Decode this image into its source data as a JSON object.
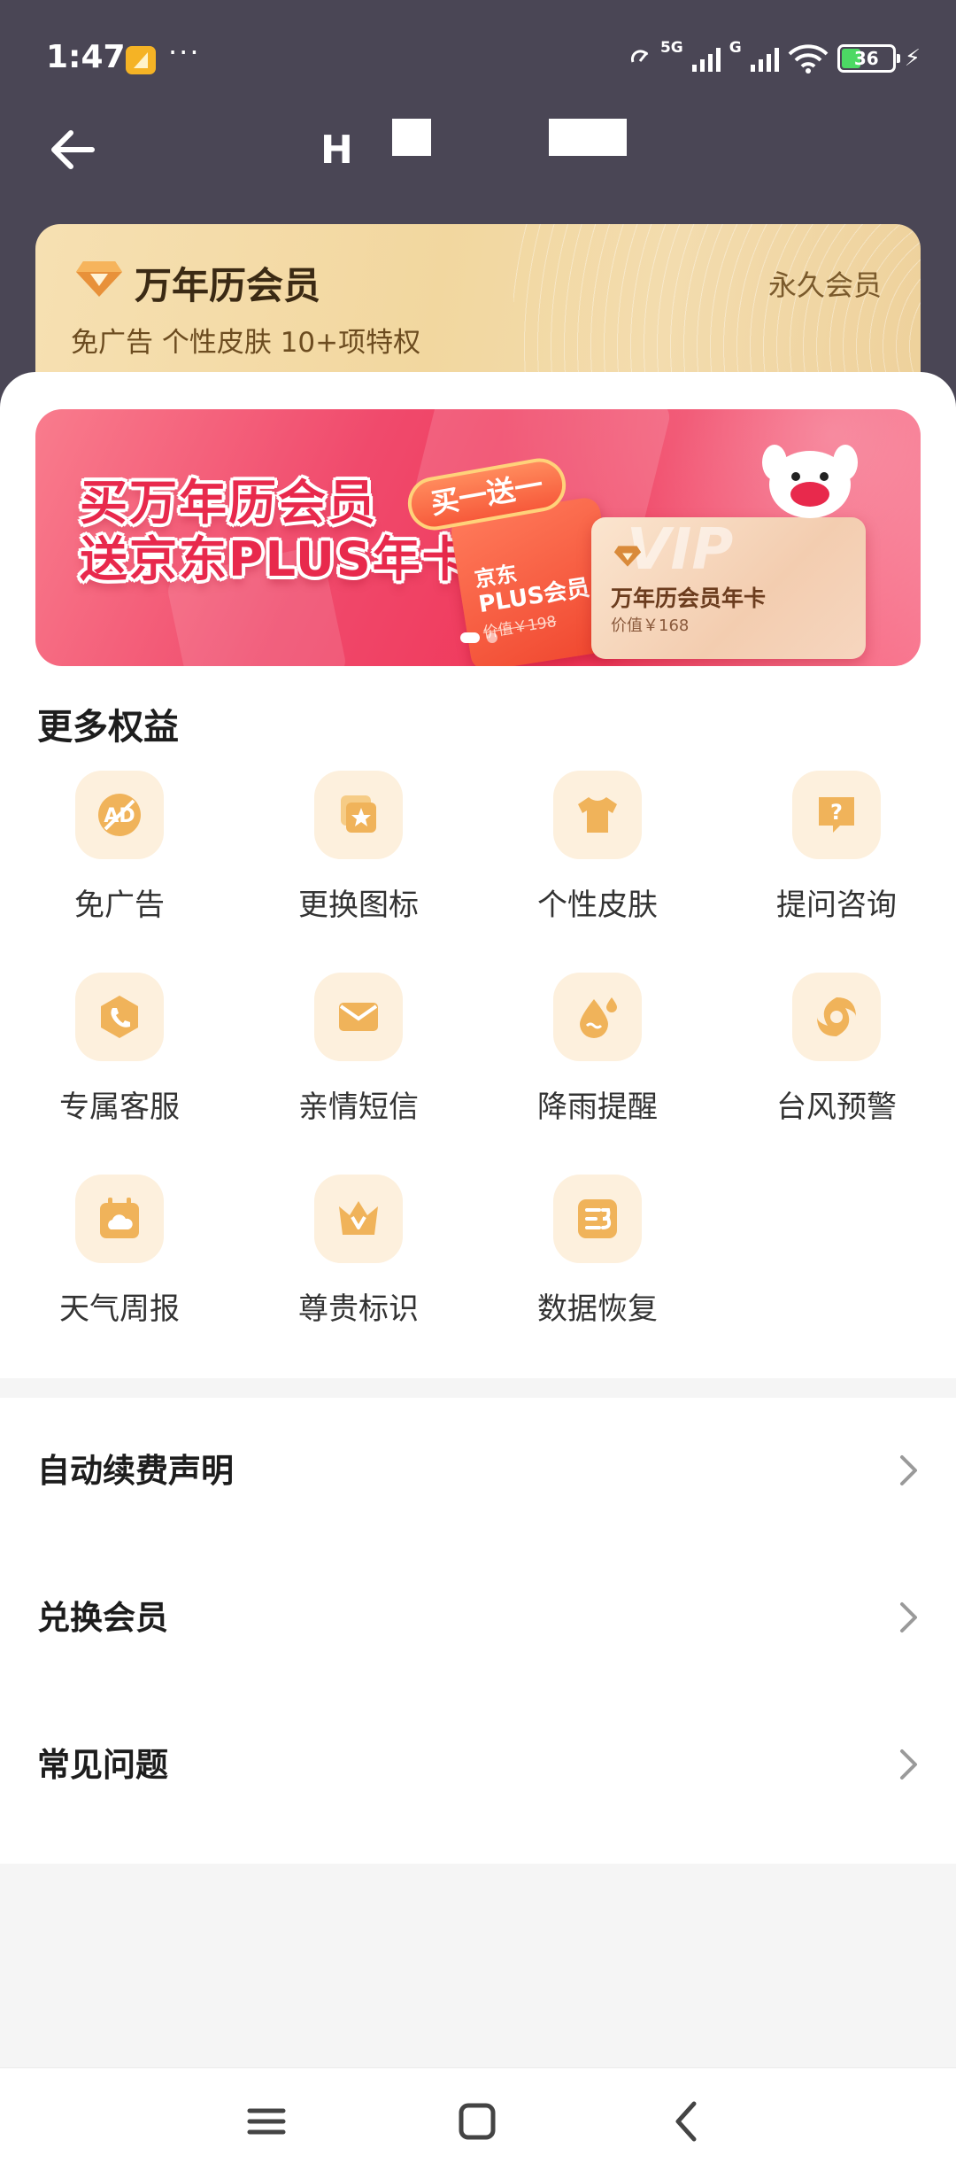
{
  "status_bar": {
    "time": "1:47",
    "more": "···",
    "network_labels": [
      "5G",
      "G"
    ],
    "battery": "36"
  },
  "nav": {
    "title_visible": "H"
  },
  "member_card": {
    "title": "万年历会员",
    "status": "永久会员",
    "subtitle": "免广告 个性皮肤 10+项特权"
  },
  "banner": {
    "headline_line1": "买万年历会员",
    "headline_line2": "送京东PLUS年卡",
    "tag": "买一送一",
    "jd_card_line1": "京东",
    "jd_card_line2": "PLUS会员",
    "jd_card_price": "价值￥198",
    "vip_watermark": "VIP",
    "vip_card_name": "万年历会员年卡",
    "vip_card_price": "价值￥168"
  },
  "benefits_section": {
    "title": "更多权益",
    "items": [
      {
        "label": "免广告",
        "icon": "no-ads-icon"
      },
      {
        "label": "更换图标",
        "icon": "change-icon-icon"
      },
      {
        "label": "个性皮肤",
        "icon": "tshirt-icon"
      },
      {
        "label": "提问咨询",
        "icon": "question-icon"
      },
      {
        "label": "专属客服",
        "icon": "phone-icon"
      },
      {
        "label": "亲情短信",
        "icon": "envelope-icon"
      },
      {
        "label": "降雨提醒",
        "icon": "raindrop-icon"
      },
      {
        "label": "台风预警",
        "icon": "typhoon-icon"
      },
      {
        "label": "天气周报",
        "icon": "calendar-cloud-icon"
      },
      {
        "label": "尊贵标识",
        "icon": "crown-icon"
      },
      {
        "label": "数据恢复",
        "icon": "data-restore-icon"
      }
    ]
  },
  "menu": [
    {
      "label": "自动续费声明"
    },
    {
      "label": "兑换会员"
    },
    {
      "label": "常见问题"
    }
  ],
  "colors": {
    "header_bg": "#4a4655",
    "gold_card": "#f3d9a6",
    "banner_red": "#ef3558",
    "icon_bg": "#fdf0dd",
    "icon_gold": "#f0b35a"
  }
}
